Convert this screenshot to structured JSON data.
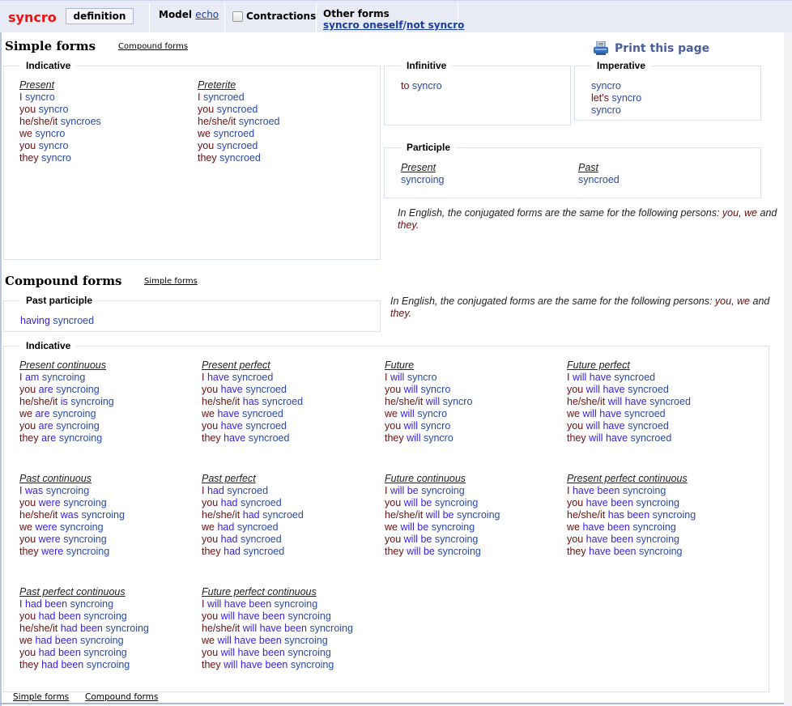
{
  "header": {
    "verb": "syncro",
    "definition_label": "definition",
    "model_label": "Model",
    "model_value": "echo",
    "contractions_label": "Contractions",
    "contractions_checked": false,
    "other_forms_label": "Other forms",
    "other_forms_link1": "syncro oneself",
    "other_forms_sep": "/",
    "other_forms_link2": "not syncro"
  },
  "print_label": "Print this page",
  "colors": {
    "verb_title": "#ee1111",
    "pronoun": "#6b1010",
    "auxiliary": "#3a22e0",
    "verb": "#2b4aa5",
    "link": "#1a3ea0"
  },
  "simple": {
    "title": "Simple forms",
    "link": "Compound forms",
    "indicative": {
      "legend": "Indicative",
      "tenses": [
        {
          "name": "Present",
          "rows": [
            [
              "I",
              "",
              "syncro"
            ],
            [
              "you",
              "",
              "syncro"
            ],
            [
              "he/she/it",
              "",
              "syncroes"
            ],
            [
              "we",
              "",
              "syncro"
            ],
            [
              "you",
              "",
              "syncro"
            ],
            [
              "they",
              "",
              "syncro"
            ]
          ]
        },
        {
          "name": "Preterite",
          "rows": [
            [
              "I",
              "",
              "syncroed"
            ],
            [
              "you",
              "",
              "syncroed"
            ],
            [
              "he/she/it",
              "",
              "syncroed"
            ],
            [
              "we",
              "",
              "syncroed"
            ],
            [
              "you",
              "",
              "syncroed"
            ],
            [
              "they",
              "",
              "syncroed"
            ]
          ]
        }
      ]
    },
    "infinitive": {
      "legend": "Infinitive",
      "prefix": "to",
      "verb": "syncro"
    },
    "imperative": {
      "legend": "Imperative",
      "rows": [
        [
          "",
          "syncro"
        ],
        [
          "let's",
          "syncro"
        ],
        [
          "",
          "syncro"
        ]
      ]
    },
    "participle": {
      "legend": "Participle",
      "present_label": "Present",
      "present_value": "syncroing",
      "past_label": "Past",
      "past_value": "syncroed"
    },
    "note": {
      "text": "In English, the conjugated forms are the same for the following persons: ",
      "you": "you",
      "comma": ", ",
      "we": "we",
      "and": " and ",
      "they": "they",
      "end": "."
    }
  },
  "compound": {
    "title": "Compound forms",
    "link": "Simple forms",
    "past_participle": {
      "legend": "Past participle",
      "aux": "having",
      "verb": "syncroed"
    },
    "note": {
      "text": "In English, the conjugated forms are the same for the following persons: ",
      "you": "you",
      "comma": ", ",
      "we": "we",
      "and": " and ",
      "they": "they",
      "end": "."
    },
    "indicative": {
      "legend": "Indicative",
      "tenses": [
        {
          "name": "Present continuous",
          "rows": [
            [
              "I",
              "am",
              "syncroing"
            ],
            [
              "you",
              "are",
              "syncroing"
            ],
            [
              "he/she/it",
              "is",
              "syncroing"
            ],
            [
              "we",
              "are",
              "syncroing"
            ],
            [
              "you",
              "are",
              "syncroing"
            ],
            [
              "they",
              "are",
              "syncroing"
            ]
          ]
        },
        {
          "name": "Present perfect",
          "rows": [
            [
              "I",
              "have",
              "syncroed"
            ],
            [
              "you",
              "have",
              "syncroed"
            ],
            [
              "he/she/it",
              "has",
              "syncroed"
            ],
            [
              "we",
              "have",
              "syncroed"
            ],
            [
              "you",
              "have",
              "syncroed"
            ],
            [
              "they",
              "have",
              "syncroed"
            ]
          ]
        },
        {
          "name": "Future",
          "rows": [
            [
              "I",
              "will",
              "syncro"
            ],
            [
              "you",
              "will",
              "syncro"
            ],
            [
              "he/she/it",
              "will",
              "syncro"
            ],
            [
              "we",
              "will",
              "syncro"
            ],
            [
              "you",
              "will",
              "syncro"
            ],
            [
              "they",
              "will",
              "syncro"
            ]
          ]
        },
        {
          "name": "Future perfect",
          "rows": [
            [
              "I",
              "will have",
              "syncroed"
            ],
            [
              "you",
              "will have",
              "syncroed"
            ],
            [
              "he/she/it",
              "will have",
              "syncroed"
            ],
            [
              "we",
              "will have",
              "syncroed"
            ],
            [
              "you",
              "will have",
              "syncroed"
            ],
            [
              "they",
              "will have",
              "syncroed"
            ]
          ]
        },
        {
          "name": "Past continuous",
          "rows": [
            [
              "I",
              "was",
              "syncroing"
            ],
            [
              "you",
              "were",
              "syncroing"
            ],
            [
              "he/she/it",
              "was",
              "syncroing"
            ],
            [
              "we",
              "were",
              "syncroing"
            ],
            [
              "you",
              "were",
              "syncroing"
            ],
            [
              "they",
              "were",
              "syncroing"
            ]
          ]
        },
        {
          "name": "Past perfect",
          "rows": [
            [
              "I",
              "had",
              "syncroed"
            ],
            [
              "you",
              "had",
              "syncroed"
            ],
            [
              "he/she/it",
              "had",
              "syncroed"
            ],
            [
              "we",
              "had",
              "syncroed"
            ],
            [
              "you",
              "had",
              "syncroed"
            ],
            [
              "they",
              "had",
              "syncroed"
            ]
          ]
        },
        {
          "name": "Future continuous",
          "rows": [
            [
              "I",
              "will be",
              "syncroing"
            ],
            [
              "you",
              "will be",
              "syncroing"
            ],
            [
              "he/she/it",
              "will be",
              "syncroing"
            ],
            [
              "we",
              "will be",
              "syncroing"
            ],
            [
              "you",
              "will be",
              "syncroing"
            ],
            [
              "they",
              "will be",
              "syncroing"
            ]
          ]
        },
        {
          "name": "Present perfect continuous",
          "rows": [
            [
              "I",
              "have been",
              "syncroing"
            ],
            [
              "you",
              "have been",
              "syncroing"
            ],
            [
              "he/she/it",
              "has been",
              "syncroing"
            ],
            [
              "we",
              "have been",
              "syncroing"
            ],
            [
              "you",
              "have been",
              "syncroing"
            ],
            [
              "they",
              "have been",
              "syncroing"
            ]
          ]
        },
        {
          "name": "Past perfect continuous",
          "rows": [
            [
              "I",
              "had been",
              "syncroing"
            ],
            [
              "you",
              "had been",
              "syncroing"
            ],
            [
              "he/she/it",
              "had been",
              "syncroing"
            ],
            [
              "we",
              "had been",
              "syncroing"
            ],
            [
              "you",
              "had been",
              "syncroing"
            ],
            [
              "they",
              "had been",
              "syncroing"
            ]
          ]
        },
        {
          "name": "Future perfect continuous",
          "rows": [
            [
              "I",
              "will have been",
              "syncroing"
            ],
            [
              "you",
              "will have been",
              "syncroing"
            ],
            [
              "he/she/it",
              "will have been",
              "syncroing"
            ],
            [
              "we",
              "will have been",
              "syncroing"
            ],
            [
              "you",
              "will have been",
              "syncroing"
            ],
            [
              "they",
              "will have been",
              "syncroing"
            ]
          ]
        }
      ]
    }
  },
  "footer": {
    "simple_link": "Simple forms",
    "compound_link": "Compound forms"
  }
}
